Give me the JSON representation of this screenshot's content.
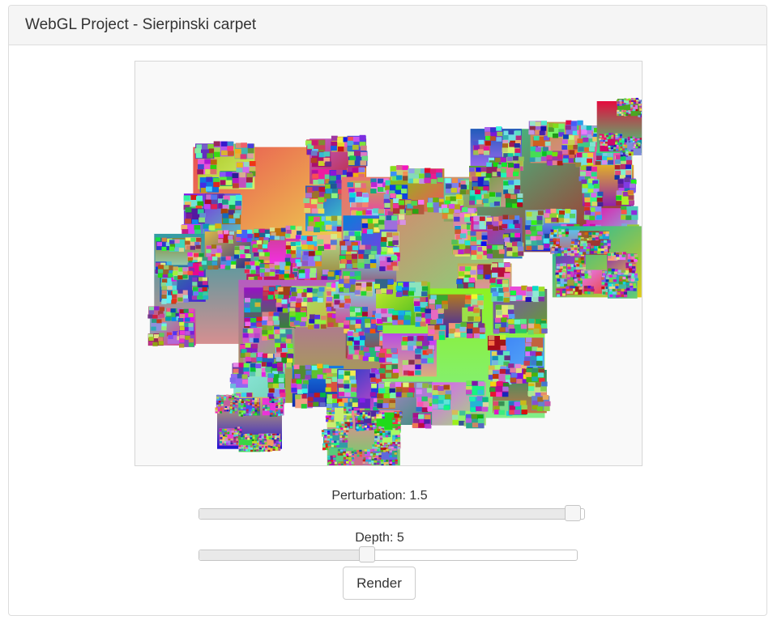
{
  "panel": {
    "title": "WebGL Project - Sierpinski carpet"
  },
  "canvas": {
    "description_icon": "webgl-canvas"
  },
  "controls": {
    "perturbation": {
      "label": "Perturbation: 1.5",
      "value": 1.5,
      "fraction": 0.97
    },
    "depth": {
      "label": "Depth: 5",
      "value": 5,
      "fraction": 0.445
    },
    "render_label": "Render"
  }
}
